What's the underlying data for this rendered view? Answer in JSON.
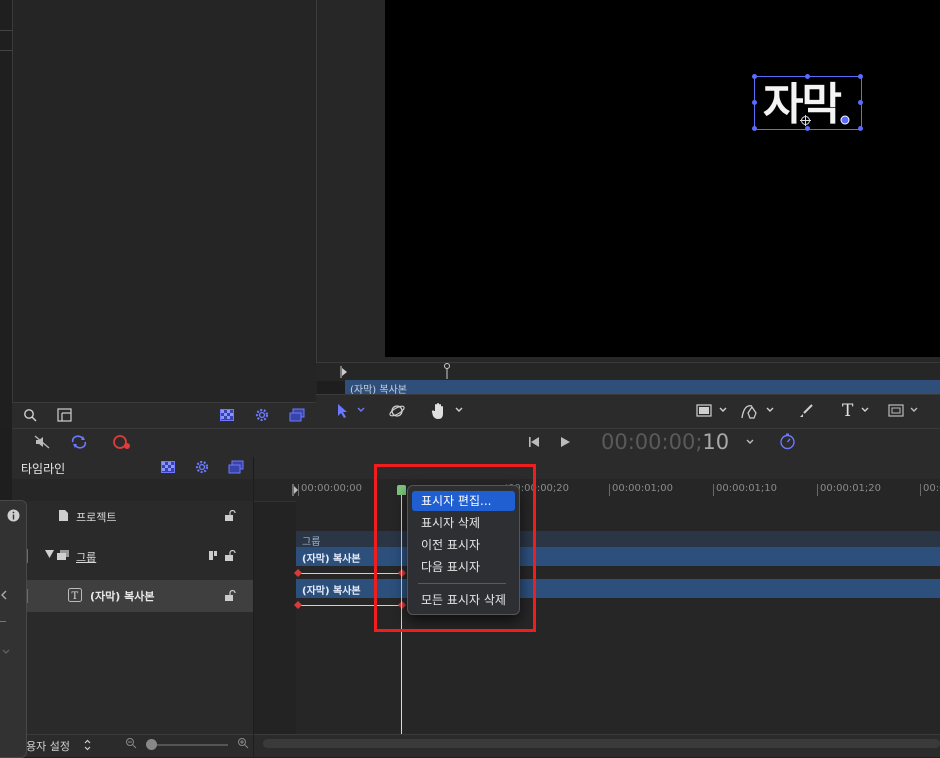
{
  "colors": {
    "accent": "#5a6bff",
    "clip": "#2c4f7c",
    "highlight": "#ee1e1e",
    "menu_active": "#1f5fd1",
    "keyframe": "#d93a3a",
    "playhead_cap": "#7cc67c"
  },
  "canvas": {
    "caption": "자막"
  },
  "mini_timeline": {
    "clip_label": "(자막) 복사본"
  },
  "transport": {
    "timecode_main": "00:00:00;",
    "timecode_frames": "10"
  },
  "timeline": {
    "title": "타임라인",
    "layers": [
      {
        "name": "프로젝트",
        "icon": "document-icon"
      },
      {
        "name": "그룹",
        "icon": "group-icon"
      },
      {
        "name": "(자막) 복사본",
        "icon": "text-T-icon"
      }
    ],
    "ruler": [
      "00:00:00;00",
      "00:00:00;20",
      "00:00:01;00",
      "00:00:01;10",
      "00:00:01;20",
      "00:00:"
    ],
    "group_label": "그룹",
    "clips": [
      "(자막) 복사본",
      "(자막) 복사본"
    ],
    "bottom_preset": "용자 설정"
  },
  "context_menu": {
    "items": [
      "표시자 편집...",
      "표시자 삭제",
      "이전 표시자",
      "다음 표시자",
      "모든 표시자 삭제"
    ],
    "active_index": 0
  }
}
